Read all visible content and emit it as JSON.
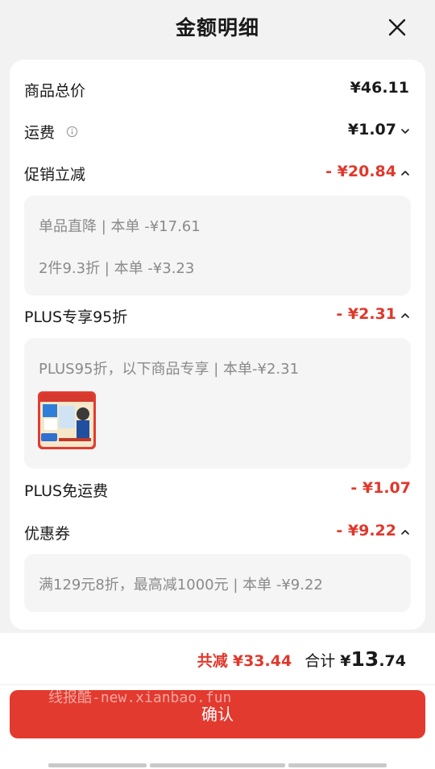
{
  "header": {
    "title": "金额明细"
  },
  "rows": {
    "goods_total": {
      "label": "商品总价",
      "amount": "¥46.11"
    },
    "shipping": {
      "label": "运费",
      "amount": "¥1.07"
    },
    "promo": {
      "label": "促销立减",
      "amount": "- ¥20.84",
      "details": [
        "单品直降 | 本单 -¥17.61",
        "2件9.3折 | 本单 -¥3.23"
      ]
    },
    "plus_discount": {
      "label": "PLUS专享95折",
      "amount": "- ¥2.31",
      "details": [
        "PLUS95折，以下商品专享 | 本单-¥2.31"
      ]
    },
    "plus_shipping": {
      "label": "PLUS免运费",
      "amount": "- ¥1.07"
    },
    "coupon": {
      "label": "优惠券",
      "amount": "- ¥9.22",
      "details": [
        "满129元8折，最高减1000元 | 本单 -¥9.22"
      ]
    }
  },
  "summary": {
    "saved_label": "共减",
    "saved_value": "¥33.44",
    "total_label": "合计",
    "total_currency": "¥",
    "total_integer": "13",
    "total_decimal": ".74"
  },
  "confirm_label": "确认",
  "watermark": "线报酷-new.xianbao.fun",
  "colors": {
    "accent": "#e0382b",
    "button": "#e33a2f"
  }
}
